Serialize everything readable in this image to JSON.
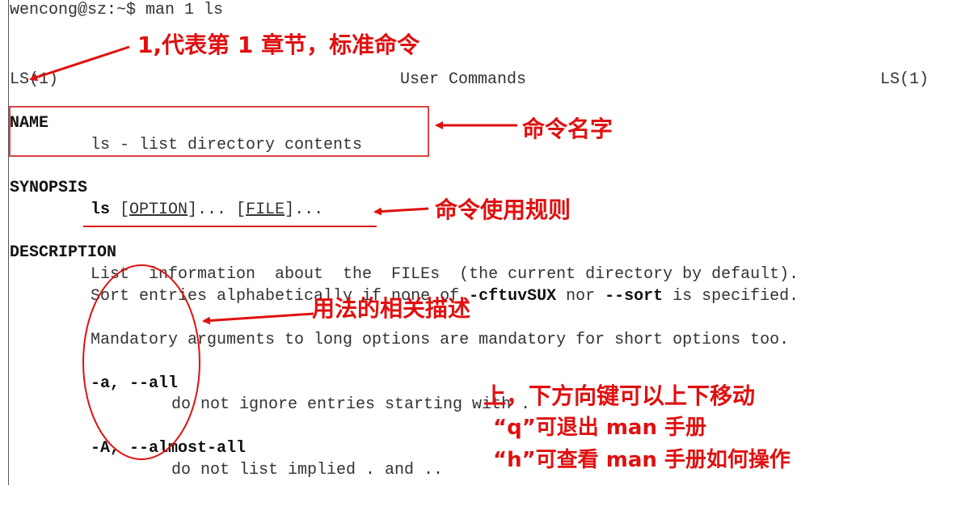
{
  "terminal": {
    "prompt": "wencong@sz:~$ man 1 ls",
    "header_left": "LS(1)",
    "header_center": "User Commands",
    "header_right": "LS(1)",
    "name_heading": "NAME",
    "name_line": "ls - list directory contents",
    "synopsis_heading": "SYNOPSIS",
    "synopsis_cmd": "ls",
    "synopsis_option": "OPTION",
    "synopsis_file": "FILE",
    "description_heading": "DESCRIPTION",
    "desc_line1": "List  information  about  the  FILEs  (the current directory by default).",
    "desc_line2_a": "Sort entries alphabetically if none of ",
    "desc_line2_b": "-cftuvSUX",
    "desc_line2_c": " nor ",
    "desc_line2_d": "--sort",
    "desc_line2_e": " is specified.",
    "desc_line3": "Mandatory arguments to long options are mandatory for short options too.",
    "opt_a": "-a, --all",
    "opt_a_desc": "do not ignore entries starting with .",
    "opt_A": "-A, --almost-all",
    "opt_A_desc": "do not list implied . and .."
  },
  "annotations": {
    "section": "1,代表第 1 章节，标准命令",
    "name": "命令名字",
    "synopsis": "命令使用规则",
    "description": "用法的相关描述",
    "keys": "上，下方向键可以上下移动",
    "quit": "“q”可退出 man 手册",
    "help": "“h”可查看 man 手册如何操作"
  },
  "colors": {
    "annotation": "#e01010",
    "text": "#333333"
  }
}
